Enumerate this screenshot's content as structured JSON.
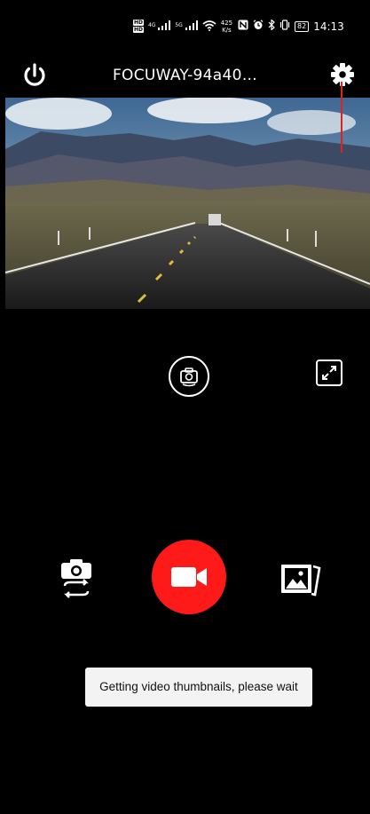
{
  "status_bar": {
    "hd_badges": [
      "HD",
      "HD"
    ],
    "signal_1_label": "4G",
    "signal_2_label": "5G",
    "net_speed_value": "425",
    "net_speed_unit": "K/s",
    "battery": "82",
    "time": "14:13"
  },
  "header": {
    "title": "FOCUWAY-94a40…",
    "power_icon": "power-icon",
    "settings_icon": "gear-icon"
  },
  "controls": {
    "snapshot_icon": "camera-switch-icon",
    "fullscreen_icon": "fullscreen-expand-icon",
    "photo_mode_icon": "camera-swap-icon",
    "record_icon": "video-camera-icon",
    "gallery_icon": "gallery-icon",
    "record_color": "#ff1a1a"
  },
  "toast": {
    "message": "Getting video thumbnails, please wait"
  }
}
